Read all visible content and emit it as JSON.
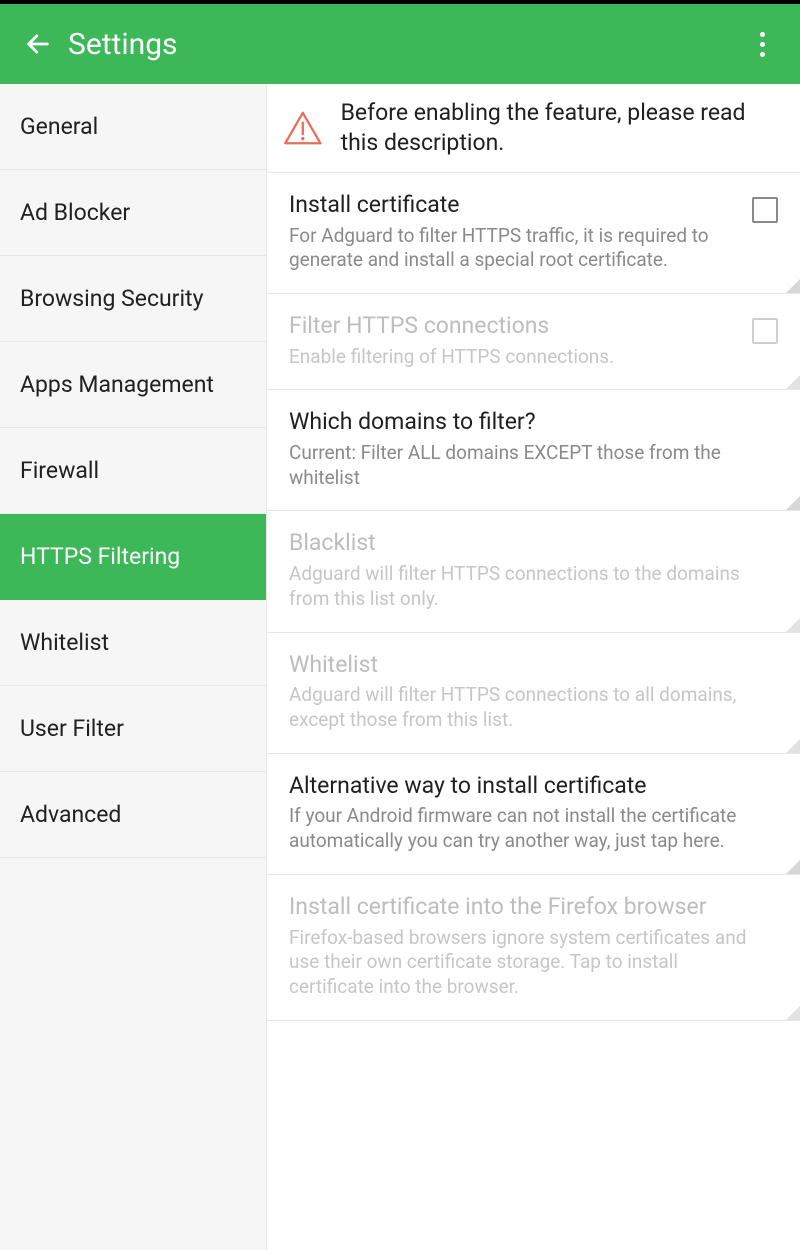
{
  "appbar": {
    "title": "Settings"
  },
  "sidebar": {
    "items": [
      {
        "label": "General",
        "selected": false
      },
      {
        "label": "Ad Blocker",
        "selected": false
      },
      {
        "label": "Browsing Security",
        "selected": false
      },
      {
        "label": "Apps Management",
        "selected": false
      },
      {
        "label": "Firewall",
        "selected": false
      },
      {
        "label": "HTTPS Filtering",
        "selected": true
      },
      {
        "label": "Whitelist",
        "selected": false
      },
      {
        "label": "User Filter",
        "selected": false
      },
      {
        "label": "Advanced",
        "selected": false
      }
    ]
  },
  "warning": {
    "text": "Before enabling the feature, please read this description."
  },
  "settings": [
    {
      "key": "install-cert",
      "title": "Install certificate",
      "sub": "For Adguard to filter HTTPS traffic, it is required to generate and install a special root certificate.",
      "checkbox": true,
      "checked": false,
      "disabled": false
    },
    {
      "key": "filter-https",
      "title": "Filter HTTPS connections",
      "sub": "Enable filtering of HTTPS connections.",
      "checkbox": true,
      "checked": false,
      "disabled": true
    },
    {
      "key": "which-domains",
      "title": "Which domains to filter?",
      "sub": "Current: Filter ALL domains EXCEPT those from the whitelist",
      "checkbox": false,
      "disabled": false
    },
    {
      "key": "blacklist",
      "title": "Blacklist",
      "sub": "Adguard will filter HTTPS connections to the domains from this list only.",
      "checkbox": false,
      "disabled": true
    },
    {
      "key": "whitelist",
      "title": "Whitelist",
      "sub": "Adguard will filter HTTPS connections to all domains, except those from this list.",
      "checkbox": false,
      "disabled": true
    },
    {
      "key": "alt-install",
      "title": "Alternative way to install certificate",
      "sub": "If your Android firmware can not install the certificate automatically you can try another way, just tap here.",
      "checkbox": false,
      "disabled": false
    },
    {
      "key": "firefox-install",
      "title": "Install certificate into the Firefox browser",
      "sub": "Firefox-based browsers ignore system certificates and use their own certificate storage. Tap to install certificate into the browser.",
      "checkbox": false,
      "disabled": true
    }
  ]
}
